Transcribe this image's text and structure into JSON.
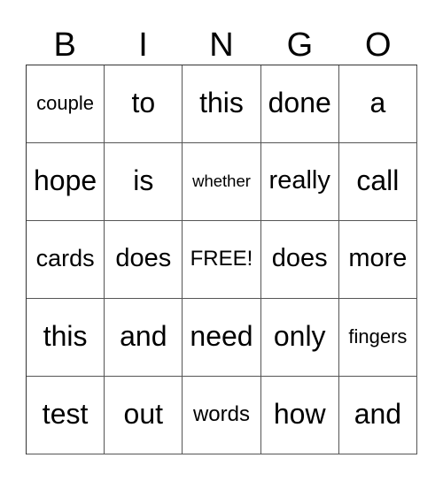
{
  "card": {
    "header": [
      "B",
      "I",
      "N",
      "G",
      "O"
    ],
    "rows": [
      [
        "couple",
        "to",
        "this",
        "done",
        "a"
      ],
      [
        "hope",
        "is",
        "whether",
        "really",
        "call"
      ],
      [
        "cards",
        "does",
        "FREE!",
        "does",
        "more"
      ],
      [
        "this",
        "and",
        "need",
        "only",
        "fingers"
      ],
      [
        "test",
        "out",
        "words",
        "how",
        "and"
      ]
    ],
    "free_space_label": "FREE!"
  }
}
